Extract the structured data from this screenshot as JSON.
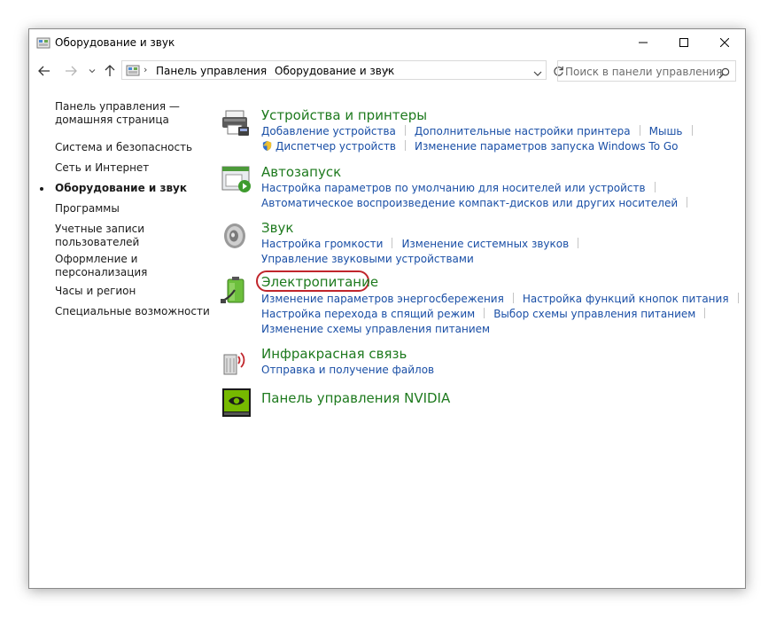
{
  "window": {
    "title": "Оборудование и звук"
  },
  "address": {
    "crumbs": [
      "Панель управления",
      "Оборудование и звук"
    ]
  },
  "search": {
    "placeholder": "Поиск в панели управления"
  },
  "sidebar": {
    "items": [
      {
        "label": "Панель управления — домашняя страница"
      },
      {
        "label": "Система и безопасность"
      },
      {
        "label": "Сеть и Интернет"
      },
      {
        "label": "Оборудование и звук",
        "active": true
      },
      {
        "label": "Программы"
      },
      {
        "label": "Учетные записи пользователей"
      },
      {
        "label": "Оформление и персонализация"
      },
      {
        "label": "Часы и регион"
      },
      {
        "label": "Специальные возможности"
      }
    ]
  },
  "categories": {
    "devices": {
      "icon": "printer-icon",
      "title": "Устройства и принтеры",
      "links": [
        "Добавление устройства",
        "Дополнительные настройки принтера",
        "Мышь",
        "Диспетчер устройств",
        "Изменение параметров запуска Windows To Go"
      ]
    },
    "autoplay": {
      "icon": "autoplay-icon",
      "title": "Автозапуск",
      "links": [
        "Настройка параметров по умолчанию для носителей или устройств",
        "Автоматическое воспроизведение компакт-дисков или других носителей"
      ]
    },
    "sound": {
      "icon": "speaker-icon",
      "title": "Звук",
      "links": [
        "Настройка громкости",
        "Изменение системных звуков",
        "Управление звуковыми устройствами"
      ]
    },
    "power": {
      "icon": "battery-icon",
      "title": "Электропитание",
      "links": [
        "Изменение параметров энергосбережения",
        "Настройка функций кнопок питания",
        "Настройка перехода в спящий режим",
        "Выбор схемы управления питанием",
        "Изменение схемы управления питанием"
      ]
    },
    "infrared": {
      "icon": "infrared-icon",
      "title": "Инфракрасная связь",
      "links": [
        "Отправка и получение файлов"
      ]
    },
    "nvidia": {
      "icon": "nvidia-icon",
      "title": "Панель управления NVIDIA"
    }
  },
  "colors": {
    "category_title": "#1e7a1e",
    "link": "#1a4fa6",
    "highlight": "#c0262c"
  }
}
